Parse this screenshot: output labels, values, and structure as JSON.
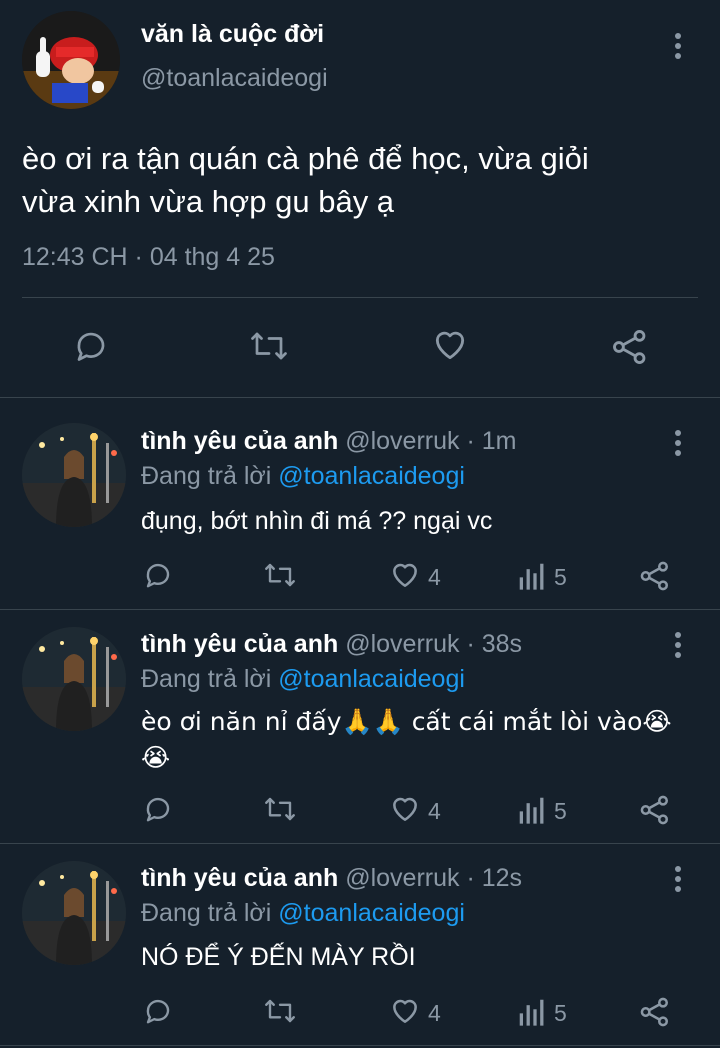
{
  "main_tweet": {
    "display_name": "văn là cuộc đời",
    "handle": "@toanlacaideogi",
    "text_line1": "èo ơi ra tận quán cà phê để học, vừa giỏi",
    "text_line2": "vừa xinh vừa hợp gu bây ạ",
    "timestamp": "12:43 CH · 04 thg 4 25"
  },
  "replies": [
    {
      "display_name": "tình yêu của anh",
      "handle_time": "@loverruk · 1m",
      "replying_label": "Đang trả lời",
      "replying_handle": "@toanlacaideogi",
      "text": "đụng, bớt nhìn đi má ?? ngại vc",
      "text_line2": "",
      "likes": "4",
      "views": "5"
    },
    {
      "display_name": "tình yêu của anh",
      "handle_time": "@loverruk · 38s",
      "replying_label": "Đang trả lời",
      "replying_handle": "@toanlacaideogi",
      "text": "èo ơi năn nỉ đấy🙏🙏 cất cái mắt lòi vào😭",
      "text_line2": "😭",
      "likes": "4",
      "views": "5"
    },
    {
      "display_name": "tình yêu của anh",
      "handle_time": "@loverruk · 12s",
      "replying_label": "Đang trả lời",
      "replying_handle": "@toanlacaideogi",
      "text": "NÓ ĐỂ Ý ĐẾN MÀY RỒI",
      "text_line2": "",
      "likes": "4",
      "views": "5"
    }
  ],
  "icons": {
    "reply": "reply-icon",
    "retweet": "retweet-icon",
    "like": "heart-icon",
    "views": "views-icon",
    "share": "share-icon",
    "more": "more-vertical-icon"
  },
  "colors": {
    "background": "#15202b",
    "text": "#ffffff",
    "muted": "#8b98a5",
    "link": "#1d9bf0",
    "divider": "#38444d"
  }
}
